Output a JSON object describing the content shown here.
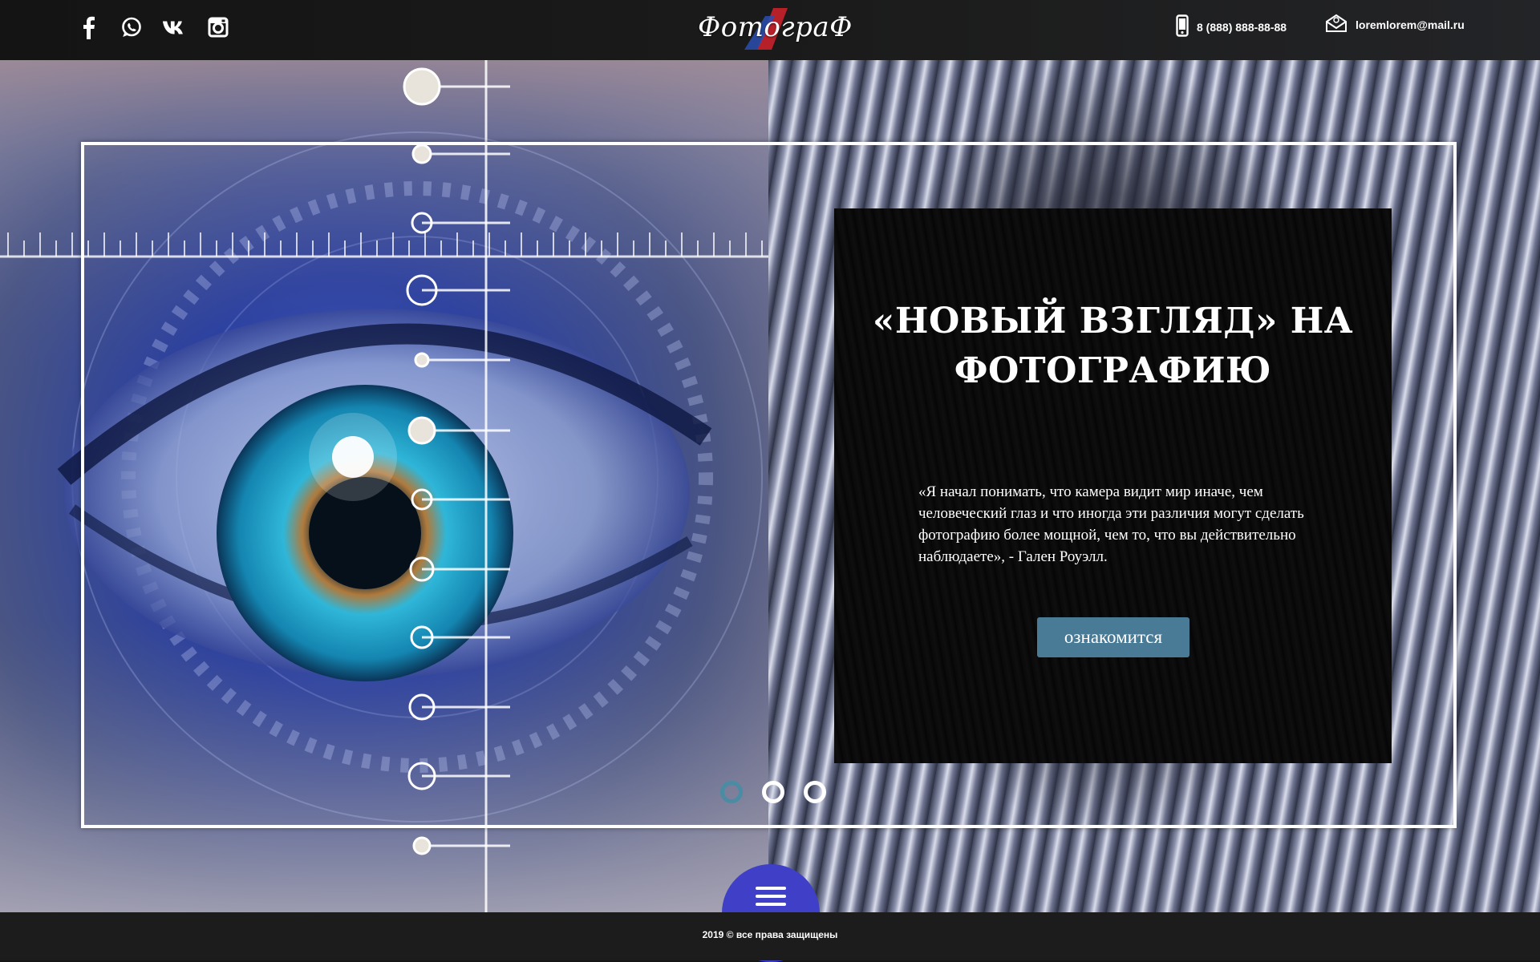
{
  "colors": {
    "header_bg": "#141414",
    "card_bg": "#050506",
    "button_bg": "#4a7b96",
    "active_dot": "#4a8ca4",
    "menu_button": "#3f3fc7",
    "footer_bg": "#1c1c1c"
  },
  "header": {
    "social": [
      {
        "name": "facebook",
        "icon": "facebook-icon"
      },
      {
        "name": "whatsapp",
        "icon": "whatsapp-icon"
      },
      {
        "name": "vk",
        "icon": "vk-icon"
      },
      {
        "name": "instagram",
        "icon": "instagram-icon"
      }
    ],
    "logo": "ФотограФ",
    "phone": {
      "icon": "phone-icon",
      "text": "8 (888) 888-88-88"
    },
    "email": {
      "icon": "envelope-icon",
      "text": "loremlorem@mail.ru"
    }
  },
  "hero": {
    "image_left": "eye-closeup-image",
    "image_right": "chrome-tunnel-image",
    "title": "«НОВЫЙ ВЗГЛЯД» НА ФОТОГРАФИЮ",
    "quote": "«Я начал понимать, что камера видит мир иначе, чем человеческий глаз и что иногда эти различия могут сделать фотографию более мощной, чем то, что вы действительно наблюдаете», - Гален Роуэлл.",
    "button_label": "ознакомится",
    "slider": {
      "count": 3,
      "active_index": 0
    }
  },
  "menu": {
    "icon": "hamburger-icon"
  },
  "footer": {
    "year": "2019",
    "copyright_icon": "©",
    "text": "все права защищены"
  }
}
